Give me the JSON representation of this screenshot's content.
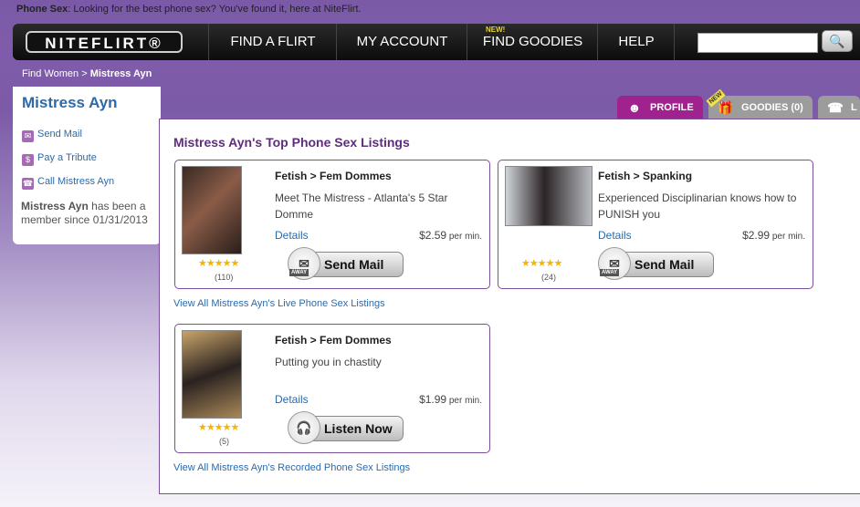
{
  "topline": {
    "bold": "Phone Sex",
    "text": ": Looking for the best phone sex? You've found it, here at NiteFlirt."
  },
  "nav": {
    "logo": "NITEFLIRT®",
    "items": [
      {
        "label": "FIND A FLIRT"
      },
      {
        "label": "MY ACCOUNT"
      },
      {
        "label": "FIND GOODIES",
        "badge": "NEW!"
      },
      {
        "label": "HELP"
      }
    ],
    "search_placeholder": "",
    "search_icon": "magnifier-icon"
  },
  "breadcrumb": {
    "link": "Find Women",
    "sep": " > ",
    "current": "Mistress Ayn"
  },
  "profile": {
    "name": "Mistress Ayn",
    "links": [
      {
        "label": "Send Mail",
        "icon": "mail-icon"
      },
      {
        "label": "Pay a Tribute",
        "icon": "dollar-icon"
      },
      {
        "label": "Call Mistress Ayn",
        "icon": "phone-icon"
      }
    ],
    "member_name": "Mistress Ayn",
    "member_text": " has been a member since 01/31/2013"
  },
  "tabs": [
    {
      "label": "PROFILE",
      "icon": "person-icon",
      "color": "#a0228f"
    },
    {
      "label": "GOODIES (0)",
      "icon": "gift-icon",
      "badge": "NEW",
      "color": "#9c9c9c"
    },
    {
      "label": "L",
      "icon": "phone-icon",
      "color": "#9c9c9c"
    }
  ],
  "listings": {
    "title": "Mistress Ayn's Top Phone Sex Listings",
    "cards": [
      {
        "category": "Fetish > Fem Dommes",
        "description": "Meet The Mistress - Atlanta's 5 Star Domme",
        "details": "Details",
        "price": "$2.59",
        "per": " per min.",
        "stars": "★★★★★",
        "count": "(110)",
        "action": "Send Mail",
        "away": "AWAY"
      },
      {
        "category": "Fetish > Spanking",
        "description": "Experienced Disciplinarian knows how to PUNISH you",
        "details": "Details",
        "price": "$2.99",
        "per": " per min.",
        "stars": "★★★★★",
        "count": "(24)",
        "action": "Send Mail",
        "away": "AWAY"
      },
      {
        "category": "Fetish > Fem Dommes",
        "description": "Putting you in chastity",
        "details": "Details",
        "price": "$1.99",
        "per": " per min.",
        "stars": "★★★★★",
        "count": "(5)",
        "action": "Listen Now"
      }
    ],
    "view_all_live": "View All Mistress Ayn's Live Phone Sex Listings",
    "view_all_recorded": "View All Mistress Ayn's Recorded Phone Sex Listings"
  }
}
